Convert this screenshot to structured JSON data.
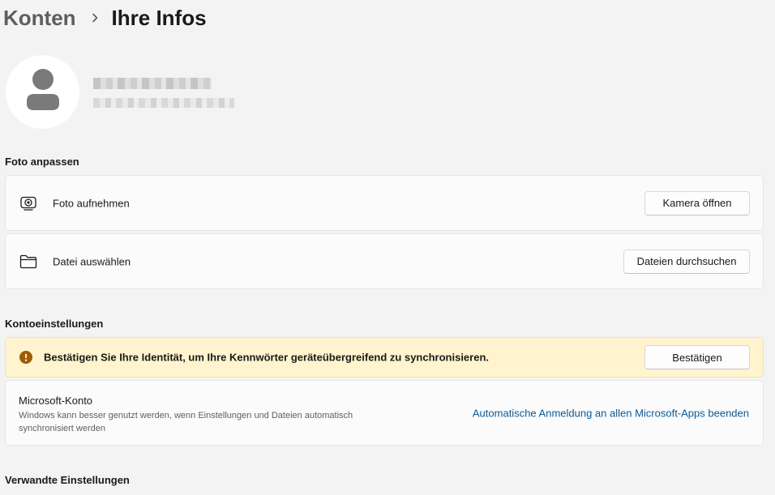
{
  "breadcrumb": {
    "parent": "Konten",
    "current": "Ihre Infos"
  },
  "profile": {
    "avatar_icon": "person-icon"
  },
  "photo_section": {
    "title": "Foto anpassen",
    "take_photo": {
      "label": "Foto aufnehmen",
      "icon": "camera-icon",
      "button": "Kamera öffnen"
    },
    "choose_file": {
      "label": "Datei auswählen",
      "icon": "folder-icon",
      "button": "Dateien durchsuchen"
    }
  },
  "account_section": {
    "title": "Kontoeinstellungen",
    "warning": {
      "icon": "warning-icon",
      "text": "Bestätigen Sie Ihre Identität, um Ihre Kennwörter geräteübergreifend zu synchronisieren.",
      "button": "Bestätigen"
    },
    "microsoft_account": {
      "title": "Microsoft-Konto",
      "description": "Windows kann besser genutzt werden, wenn Einstellungen und Dateien automatisch synchronisiert werden",
      "link": "Automatische Anmeldung an allen Microsoft-Apps beenden"
    }
  },
  "related_section": {
    "title": "Verwandte Einstellungen"
  },
  "colors": {
    "background": "#f3f3f3",
    "card": "#fbfbfb",
    "warning_bg": "#fff4ce",
    "warning_icon": "#9d5d00",
    "link": "#0a5a9a"
  }
}
